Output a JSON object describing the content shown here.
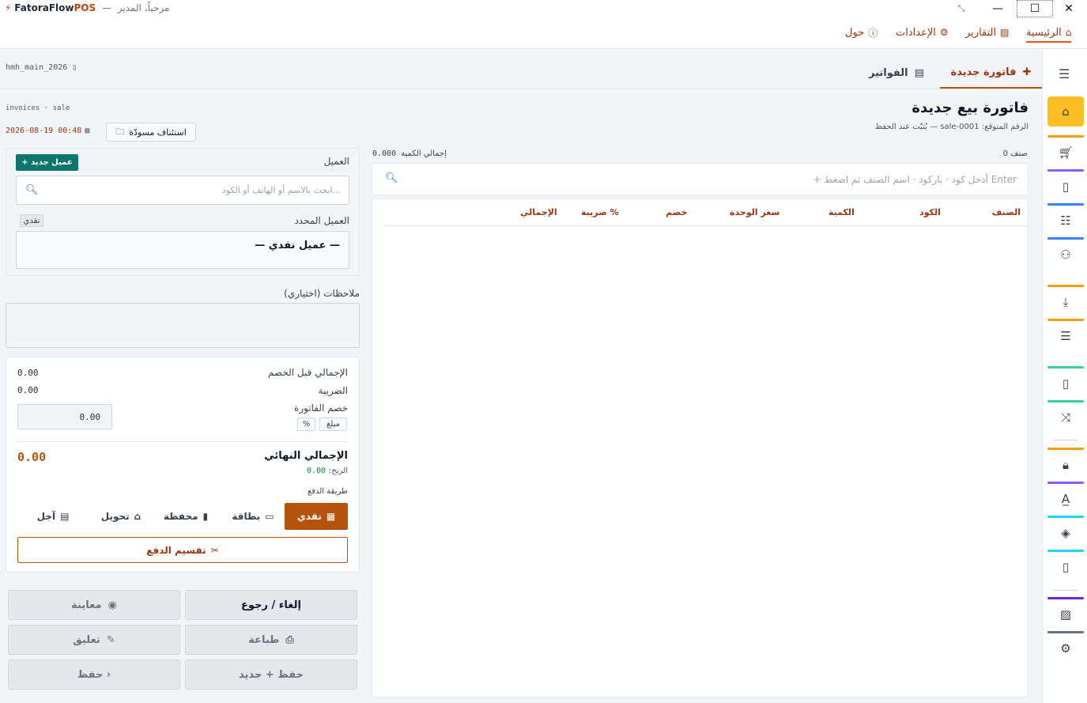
{
  "app": {
    "name_part1": "FatoraFlow",
    "name_part2": "POS",
    "separator": "—",
    "greeting": "مرحباً، المدير"
  },
  "window_controls": {
    "restore": "⤡",
    "minimize": "—",
    "maximize": "☐",
    "close": "✕"
  },
  "menu": {
    "home": "الرئيسية",
    "reports": "التقارير",
    "settings": "الإعدادات",
    "about": "حول"
  },
  "tabs": {
    "new_invoice": "فاتورة جديدة",
    "invoices": "الفواتير",
    "db_name": "hmh_main_2026"
  },
  "page": {
    "title": "فاتورة بيع جديدة",
    "expected_label": "الرقم المتوقع:",
    "expected_number": "sale-0001",
    "expected_note": "— يُثبّت عند الحفظ",
    "breadcrumb": "invoices · sale",
    "resume_draft": "استئناف مسودّة",
    "datetime": "2026-08-19 00:48"
  },
  "items": {
    "count_label": "0 صنف",
    "total_qty_label": "إجمالي الكمية",
    "total_qty": "0.000",
    "search_placeholder": "+ أدخل كود · باركود · اسم الصنف ثم اضغط Enter",
    "columns": [
      "الصنف",
      "الكود",
      "الكمية",
      "سعر الوحدة",
      "خصم",
      "ضريبة %",
      "الإجمالي"
    ]
  },
  "customer": {
    "label": "العميل",
    "new_button": "+ عميل جديد",
    "search_placeholder": "ابحث بالاسم أو الهاتف أو الكود...",
    "selected_label": "العميل المحدد",
    "selected_badge": "نقدي",
    "selected_name": "— عميل نقدي —"
  },
  "notes": {
    "label": "ملاحظات (اختياري)"
  },
  "totals": {
    "subtotal_label": "الإجمالي قبل الخصم",
    "subtotal": "0.00",
    "tax_label": "الضريبة",
    "tax": "0.00",
    "discount_label": "خصم الفاتورة",
    "discount_value": "0.00",
    "discount_amount_toggle": "مبلغ",
    "discount_percent_toggle": "%",
    "final_label": "الإجمالي النهائي",
    "final": "0.00",
    "profit_label": "الربح:",
    "profit": "0.00"
  },
  "payment": {
    "label": "طريقة الدفع",
    "cash": "نقدي",
    "card": "بطاقة",
    "wallet": "محفظة",
    "transfer": "تحويل",
    "credit": "آجل",
    "split": "تقسيم الدفع"
  },
  "actions": {
    "cancel": "إلغاء / رجوع",
    "preview": "معاينة",
    "print": "طباعة",
    "hold": "تعليق",
    "save_new": "حفظ + جديد",
    "save": "حفظ ›"
  },
  "colors": {
    "accent": "#b45309",
    "accent_text": "#9a3412",
    "new_customer": "#0f766e",
    "profit": "#15803d"
  }
}
